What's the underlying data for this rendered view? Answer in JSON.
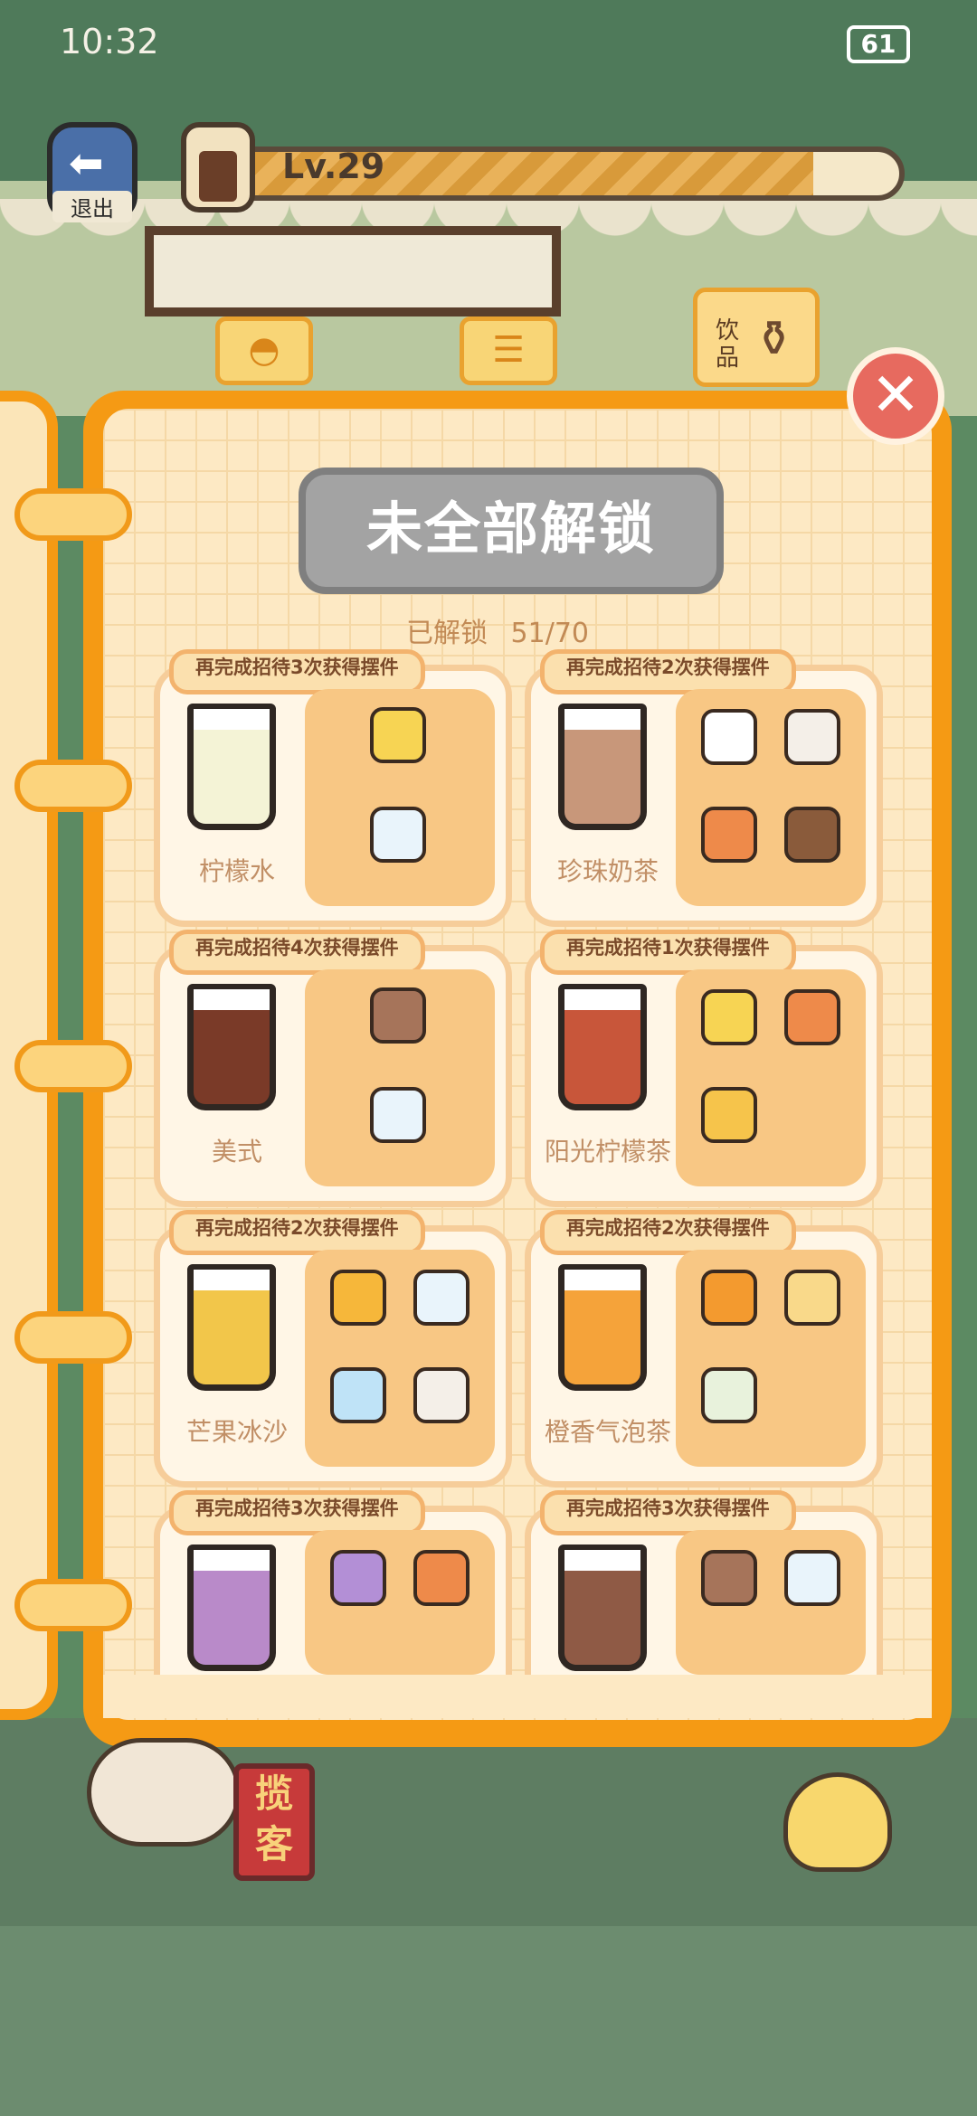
{
  "status": {
    "time": "10:32",
    "battery": "61"
  },
  "hud": {
    "exit_label": "退出",
    "level": "Lv.29",
    "level_progress": 0.88
  },
  "tabs": [
    {
      "name": "bread"
    },
    {
      "name": "menu"
    },
    {
      "name": "drinks",
      "label": "饮品",
      "active": true
    }
  ],
  "book": {
    "title": "未全部解锁",
    "progress_label": "已解锁",
    "progress_value": "51/70"
  },
  "recipes": [
    {
      "tag": "再完成招待3次获得摆件",
      "name": "柠檬水",
      "cup_color": "#f4f3d6",
      "ingredients": [
        "lemon-slices",
        "water-bottle"
      ]
    },
    {
      "tag": "再完成招待2次获得摆件",
      "name": "珍珠奶茶",
      "cup_color": "#c8977a",
      "ingredients": [
        "milk-jug",
        "sugar-jar",
        "tea-glass",
        "pearls-jar"
      ]
    },
    {
      "tag": "再完成招待4次获得摆件",
      "name": "美式",
      "cup_color": "#7a3a28",
      "ingredients": [
        "coffee-beans",
        "water-bottle"
      ]
    },
    {
      "tag": "再完成招待1次获得摆件",
      "name": "阳光柠檬茶",
      "cup_color": "#c8563a",
      "ingredients": [
        "lemon-slices",
        "tea-glass",
        "honey-jar"
      ]
    },
    {
      "tag": "再完成招待2次获得摆件",
      "name": "芒果冰沙",
      "cup_color": "#f2c64a",
      "ingredients": [
        "mango",
        "water-bottle",
        "ice-cubes",
        "sugar-jar"
      ]
    },
    {
      "tag": "再完成招待2次获得摆件",
      "name": "橙香气泡茶",
      "cup_color": "#f5a33a",
      "ingredients": [
        "orange-slices",
        "jasmine-tea",
        "soda-bottle"
      ]
    },
    {
      "tag": "再完成招待3次获得摆件",
      "name": "",
      "cup_color": "#b98ac9",
      "ingredients": [
        "taro",
        "tea-glass",
        "milk-jug",
        "sugar-jar"
      ]
    },
    {
      "tag": "再完成招待3次获得摆件",
      "name": "",
      "cup_color": "#8f5a45",
      "ingredients": [
        "coffee-beans",
        "water-bottle",
        "milk-jug"
      ]
    }
  ],
  "scene": {
    "sign_text": "揽客"
  },
  "colors": {
    "book_orange": "#f59a14",
    "card_border": "#f6cd9a",
    "locked_gray": "#a3a3a3"
  }
}
